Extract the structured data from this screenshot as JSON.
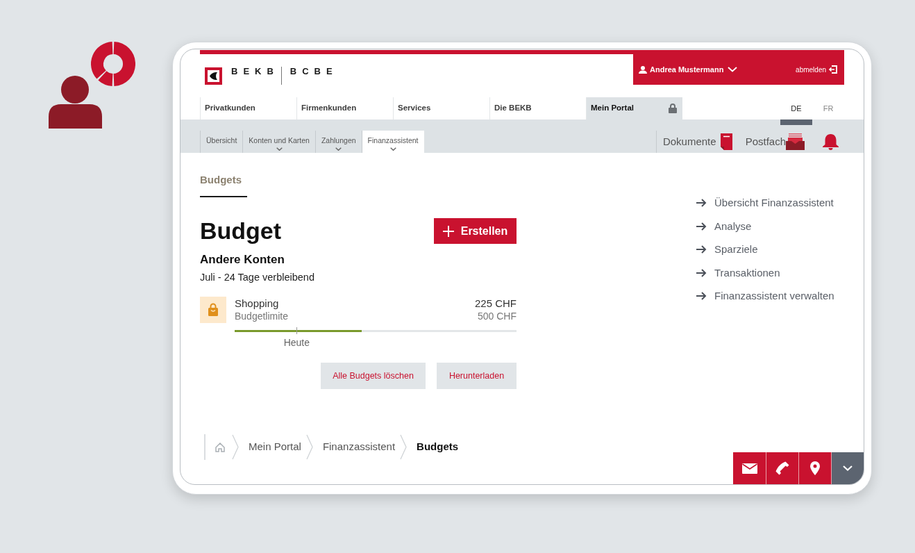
{
  "header": {
    "logo_text": [
      "BEKB",
      "BCBE"
    ],
    "user_name": "Andrea Mustermann",
    "logout": "abmelden"
  },
  "main_nav": [
    {
      "label": "Privatkunden",
      "selected": false,
      "locked": false
    },
    {
      "label": "Firmenkunden",
      "selected": false,
      "locked": false
    },
    {
      "label": "Services",
      "selected": false,
      "locked": false
    },
    {
      "label": "Die BEKB",
      "selected": false,
      "locked": false
    },
    {
      "label": "Mein Portal",
      "selected": true,
      "locked": true
    }
  ],
  "languages": [
    {
      "label": "DE",
      "selected": true
    },
    {
      "label": "FR",
      "selected": false
    }
  ],
  "sub_nav": [
    {
      "label": "Übersicht",
      "selected": false,
      "has_submenu": false
    },
    {
      "label": "Konten und Karten",
      "selected": false,
      "has_submenu": true
    },
    {
      "label": "Zahlungen",
      "selected": false,
      "has_submenu": true
    },
    {
      "label": "Finanzassistent",
      "selected": true,
      "has_submenu": true
    }
  ],
  "quick_links": [
    {
      "kind": "documents",
      "label": "Dokumente"
    },
    {
      "kind": "inbox",
      "label": "Postfach"
    },
    {
      "kind": "notifications"
    }
  ],
  "section_tabs": [
    {
      "label": "Budgets",
      "selected": true
    }
  ],
  "title": "Budget",
  "create_button": "Erstellen",
  "account": "Andere Konten",
  "period": "Juli - 24 Tage verbleibend",
  "budgets": [
    {
      "kind": "shopping",
      "category": "Shopping",
      "spent": "225 CHF",
      "limit_label": "Budgetlimite",
      "limit": "500 CHF",
      "level": 0.45,
      "today_label": "Heute"
    }
  ],
  "actions": [
    {
      "kind": "delete_all",
      "label": "Alle Budgets löschen"
    },
    {
      "kind": "download",
      "label": "Herunterladen"
    }
  ],
  "side_links": [
    "Übersicht Finanzassistent",
    "Analyse",
    "Sparziele",
    "Transaktionen",
    "Finanzassistent verwalten"
  ],
  "breadcrumb": [
    {
      "label": "Mein Portal",
      "current": false
    },
    {
      "label": "Finanzassistent",
      "current": false
    },
    {
      "label": "Budgets",
      "current": true
    }
  ],
  "contact_bar": [
    {
      "kind": "mail"
    },
    {
      "kind": "phone"
    },
    {
      "kind": "location"
    },
    {
      "kind": "collapse"
    }
  ]
}
